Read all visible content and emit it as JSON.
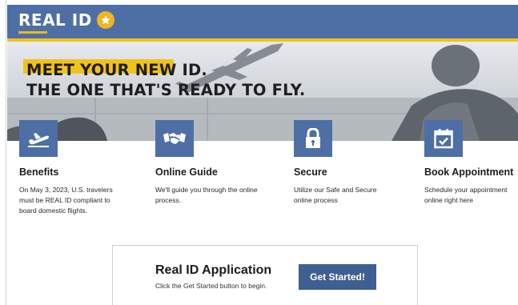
{
  "header": {
    "logo_text": "REAL ID",
    "logo_icon": "star-badge-icon"
  },
  "hero": {
    "headline_line1": "MEET YOUR NEW ID.",
    "headline_line2": "THE ONE THAT'S READY TO FLY."
  },
  "features": [
    {
      "icon": "airplane-takeoff-icon",
      "title": "Benefits",
      "text": "On May 3, 2023, U.S. travelers must be REAL ID compliant to board domestic flights."
    },
    {
      "icon": "handshake-icon",
      "title": "Online Guide",
      "text": "We'll guide you through the online process."
    },
    {
      "icon": "lock-icon",
      "title": "Secure",
      "text": "Utilize our Safe and Secure online process"
    },
    {
      "icon": "calendar-check-icon",
      "title": "Book Appointment",
      "text": "Schedule your appointment online right here"
    }
  ],
  "cta": {
    "title": "Real ID Application",
    "subtitle": "Click the Get Started button to begin.",
    "button_label": "Get Started!"
  },
  "colors": {
    "brand_blue": "#4d6fa6",
    "accent_yellow": "#f2c21c",
    "button_blue": "#3e5f91"
  }
}
